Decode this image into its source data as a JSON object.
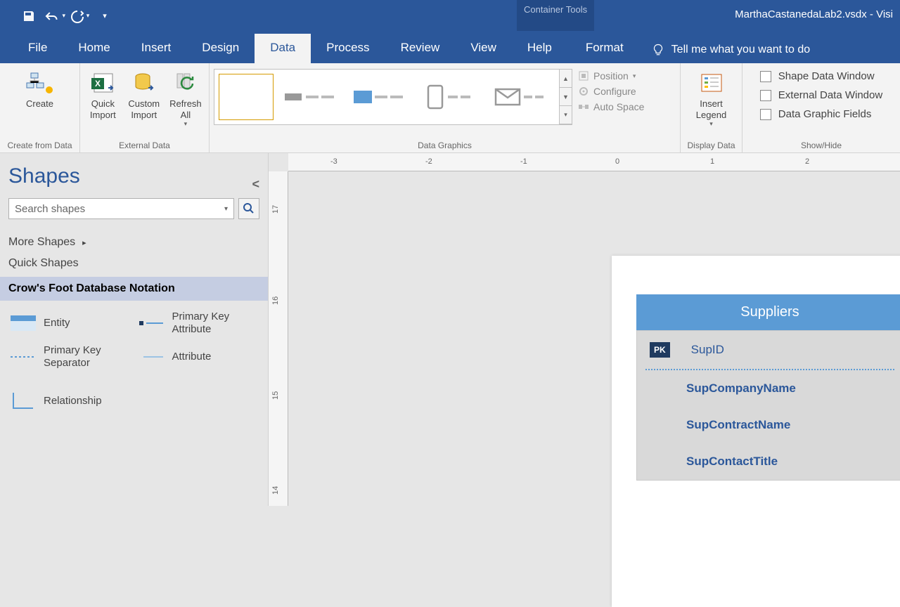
{
  "title": {
    "context_tool": "Container Tools",
    "doc": "MarthaCastanedaLab2.vsdx  -  Visi"
  },
  "tabs": {
    "file": "File",
    "home": "Home",
    "insert": "Insert",
    "design": "Design",
    "data": "Data",
    "process": "Process",
    "review": "Review",
    "view": "View",
    "help": "Help",
    "format": "Format",
    "tellme": "Tell me what you want to do"
  },
  "ribbon": {
    "g1": {
      "label": "Create from Data",
      "create": "Create"
    },
    "g2": {
      "label": "External Data",
      "quick": "Quick\nImport",
      "custom": "Custom\nImport",
      "refresh": "Refresh\nAll"
    },
    "g3": {
      "label": "Data Graphics"
    },
    "g4": {
      "position": "Position",
      "configure": "Configure",
      "autospace": "Auto Space"
    },
    "g5": {
      "label": "Display Data",
      "legend": "Insert\nLegend"
    },
    "g6": {
      "label": "Show/Hide",
      "c1": "Shape Data Window",
      "c2": "External Data Window",
      "c3": "Data Graphic Fields"
    }
  },
  "shapes": {
    "title": "Shapes",
    "search_placeholder": "Search shapes",
    "more": "More Shapes",
    "quick": "Quick Shapes",
    "selected": "Crow's Foot Database Notation",
    "items": {
      "entity": "Entity",
      "pka": "Primary Key Attribute",
      "pks": "Primary Key Separator",
      "attr": "Attribute",
      "rel": "Relationship"
    }
  },
  "ruler": {
    "h": [
      "-3",
      "-2",
      "-1",
      "0",
      "1",
      "2"
    ],
    "v": [
      "17",
      "16",
      "15",
      "14"
    ]
  },
  "entity": {
    "name": "Suppliers",
    "pk_badge": "PK",
    "attrs": [
      "SupID",
      "SupCompanyName",
      "SupContractName",
      "SupContactTitle"
    ]
  }
}
